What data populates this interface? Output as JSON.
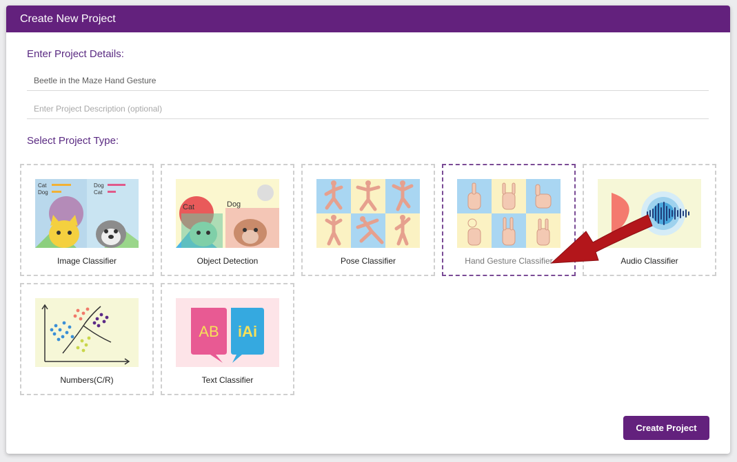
{
  "dialog": {
    "title": "Create New Project"
  },
  "details": {
    "heading": "Enter Project Details:",
    "name_value": "Beetle in the Maze Hand Gesture",
    "description_placeholder": "Enter Project Description (optional)"
  },
  "types": {
    "heading": "Select Project Type:",
    "items": [
      {
        "label": "Image Classifier"
      },
      {
        "label": "Object Detection"
      },
      {
        "label": "Pose Classifier"
      },
      {
        "label": "Hand Gesture Classifier",
        "selected": true
      },
      {
        "label": "Audio Classifier"
      },
      {
        "label": "Numbers(C/R)"
      },
      {
        "label": "Text Classifier"
      }
    ],
    "image_classifier_labels": [
      "Cat",
      "Dog",
      "Dog",
      "Cat"
    ],
    "object_detection_labels": [
      "Cat",
      "Dog"
    ],
    "text_classifier_labels": [
      "AB",
      "iAi"
    ]
  },
  "actions": {
    "create_label": "Create Project"
  },
  "colors": {
    "accent": "#63217d",
    "arrow": "#b3161b"
  }
}
